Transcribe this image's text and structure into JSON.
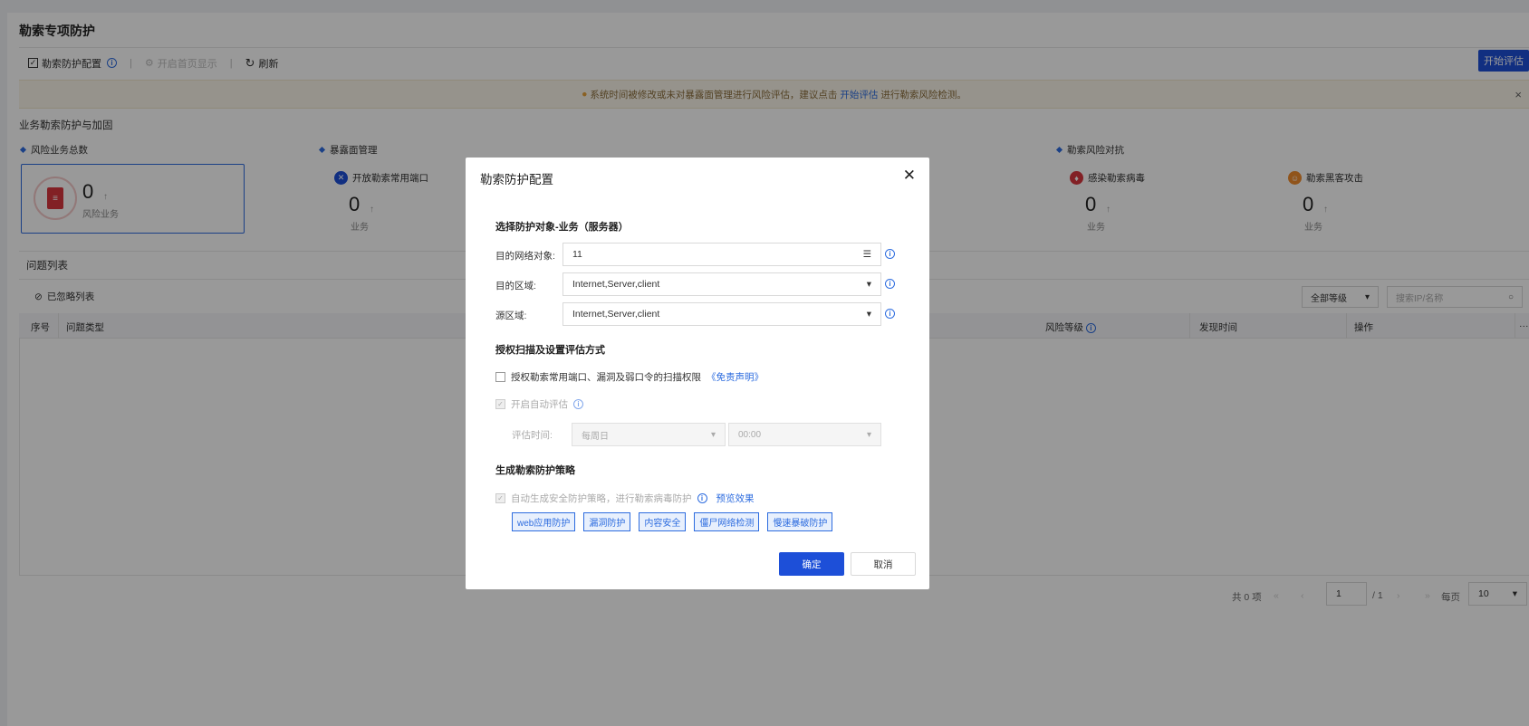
{
  "page": {
    "title": "勒索专项防护"
  },
  "toolbar": {
    "config_label": "勒索防护配置",
    "homepage_label": "开启首页显示",
    "refresh_label": "刷新",
    "start_eval_label": "开始评估"
  },
  "notice": {
    "text_before": "系统时间被修改或未对暴露面管理进行风险评估，建议点击",
    "link": "开始评估",
    "text_after": "进行勒索风险检测。"
  },
  "overview": {
    "section_title": "业务勒索防护与加固",
    "risk_total": {
      "label": "风险业务总数",
      "value": "0",
      "unit": "风险业务"
    },
    "exposure": {
      "label": "暴露面管理",
      "stat_title": "开放勒索常用端口",
      "value": "0",
      "unit": "业务"
    },
    "counter": {
      "label": "勒索风险对抗",
      "virus": {
        "title": "感染勒索病毒",
        "value": "0",
        "unit": "业务"
      },
      "hacker": {
        "title": "勒索黑客攻击",
        "value": "0",
        "unit": "业务"
      }
    }
  },
  "issues": {
    "title": "问题列表",
    "ignored_label": "已忽略列表",
    "level_select": "全部等级",
    "search_placeholder": "搜索IP/名称",
    "columns": [
      "序号",
      "问题类型",
      "风险等级",
      "发现时间",
      "操作"
    ],
    "more": "···"
  },
  "pager": {
    "total": "共 0 项",
    "page": "1",
    "pages": "/ 1",
    "per_page_label": "每页",
    "per_page": "10"
  },
  "modal": {
    "title": "勒索防护配置",
    "close": "✕",
    "sec1_title": "选择防护对象-业务（服务器）",
    "target_label": "目的网络对象:",
    "target_value": "11",
    "dest_zone_label": "目的区域:",
    "dest_zone_value": "Internet,Server,client",
    "src_zone_label": "源区域:",
    "src_zone_value": "Internet,Server,client",
    "sec2_title": "授权扫描及设置评估方式",
    "auth_scan_label": "授权勒索常用端口、漏洞及弱口令的扫描权限",
    "disclaimer_link": "《免责声明》",
    "auto_eval_label": "开启自动评估",
    "eval_time_label": "评估时间:",
    "eval_day": "每周日",
    "eval_time": "00:00",
    "sec3_title": "生成勒索防护策略",
    "auto_policy_label": "自动生成安全防护策略，进行勒索病毒防护",
    "preview_link": "预览效果",
    "tags": [
      "web应用防护",
      "漏洞防护",
      "内容安全",
      "僵尸网络检测",
      "慢速暴破防护"
    ],
    "ok_label": "确定",
    "cancel_label": "取消"
  }
}
